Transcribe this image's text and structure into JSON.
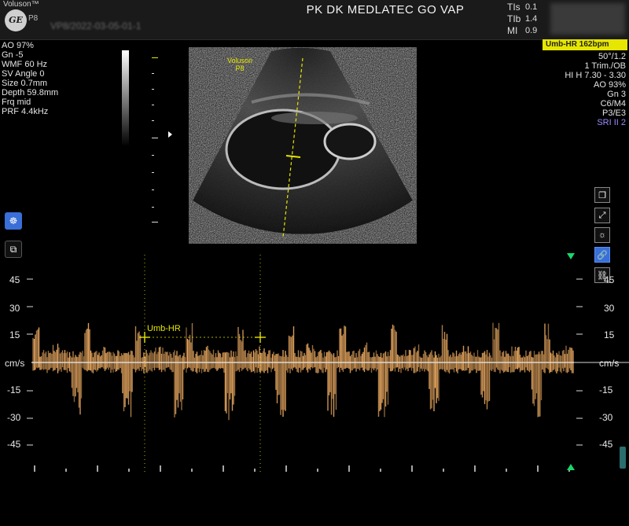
{
  "header": {
    "brand": "Voluson™",
    "logo_text": "GE",
    "probe": "P8",
    "patient_id": "VP8/2022-03-05-01-1",
    "clinic": "PK DK MEDLATEC GO VAP",
    "indices": [
      {
        "label": "TIs",
        "value": "0.1"
      },
      {
        "label": "TIb",
        "value": "1.4"
      },
      {
        "label": "MI",
        "value": "0.9"
      }
    ]
  },
  "left_params": [
    "AO 97%",
    "Gn  -5",
    "WMF 60 Hz",
    "SV Angle  0",
    "Size  0.7mm",
    "Depth 59.8mm",
    "Frq mid",
    "PRF  4.4kHz"
  ],
  "right_params": {
    "badge": "Umb-HR 162bpm",
    "lines": [
      "50°/1.2",
      "1 Trim./OB",
      "HI H  7.30 - 3.30",
      "AO 93%",
      "Gn  3",
      "C6/M4",
      "P3/E3"
    ],
    "sri": "SRI II 2"
  },
  "image_label": {
    "line1": "Voluson",
    "line2": "P8"
  },
  "left_tools": [
    {
      "name": "probe-view-icon",
      "glyph": "☸"
    },
    {
      "name": "crop-icon",
      "glyph": "⧉"
    }
  ],
  "right_tools": [
    {
      "name": "copy-icon",
      "glyph": "❐"
    },
    {
      "name": "fullscreen-icon",
      "glyph": "⤢"
    },
    {
      "name": "brightness-icon",
      "glyph": "☼"
    },
    {
      "name": "link-icon",
      "glyph": "🔗"
    },
    {
      "name": "unlink-icon",
      "glyph": "⛓"
    }
  ],
  "doppler": {
    "unit": "cm/s",
    "ticks_left": [
      "45",
      "30",
      "15",
      "-15",
      "-30",
      "-45"
    ],
    "ticks_right": [
      "45",
      "30",
      "15",
      "-15",
      "-30",
      "-45"
    ],
    "measurement_label": "Umb-HR"
  },
  "colors": {
    "accent_yellow": "#e6e600",
    "marker_green": "#19d86b",
    "tool_blue": "#3a6fd8",
    "doppler_orange": "#e8a860"
  }
}
